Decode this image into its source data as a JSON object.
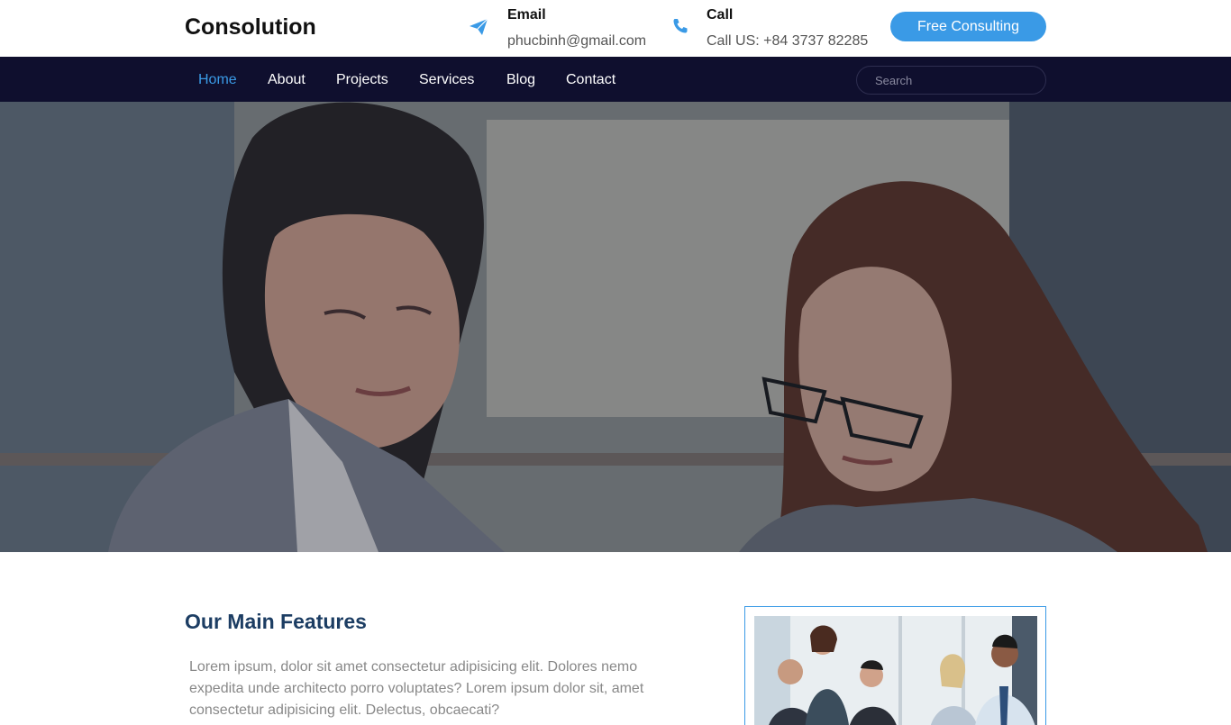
{
  "brand": {
    "name": "Consolution"
  },
  "contact": {
    "email": {
      "title": "Email",
      "value": "phucbinh@gmail.com",
      "icon": "paper-plane-icon"
    },
    "call": {
      "title": "Call",
      "value": "Call US: +84 3737 82285",
      "icon": "phone-icon"
    }
  },
  "cta": {
    "label": "Free Consulting"
  },
  "nav": {
    "items": [
      {
        "label": "Home",
        "active": true
      },
      {
        "label": "About"
      },
      {
        "label": "Projects"
      },
      {
        "label": "Services"
      },
      {
        "label": "Blog"
      },
      {
        "label": "Contact"
      }
    ],
    "search_placeholder": "Search"
  },
  "features": {
    "title": "Our Main Features",
    "text": "Lorem ipsum, dolor sit amet consectetur adipisicing elit. Dolores nemo expedita unde architecto porro voluptates? Lorem ipsum dolor sit, amet consectetur adipisicing elit. Delectus, obcaecati?"
  },
  "colors": {
    "accent": "#3a9ae6",
    "nav_bg": "#0f0f2e",
    "heading": "#1c3d63"
  }
}
